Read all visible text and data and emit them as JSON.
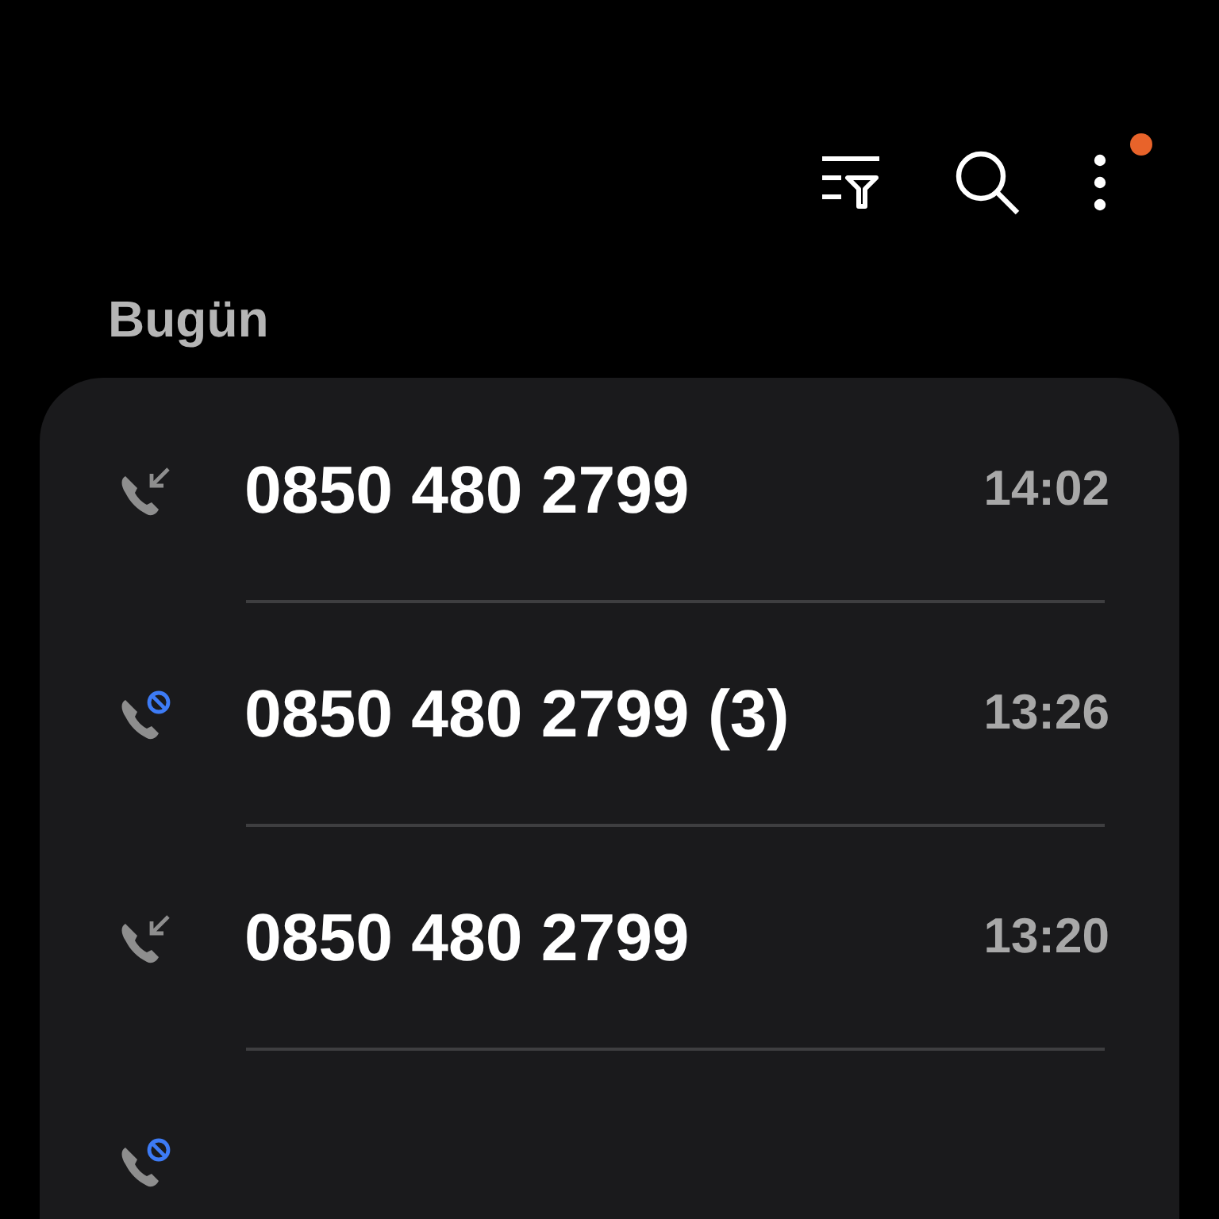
{
  "toolbar": {
    "notification_dot": true
  },
  "section_title": "Bugün",
  "calls": [
    {
      "kind": "incoming",
      "number": "0850 480 2799",
      "time": "14:02"
    },
    {
      "kind": "blocked",
      "number": "0850 480 2799 (3)",
      "time": "13:26"
    },
    {
      "kind": "incoming",
      "number": "0850 480 2799",
      "time": "13:20"
    },
    {
      "kind": "blocked"
    }
  ]
}
